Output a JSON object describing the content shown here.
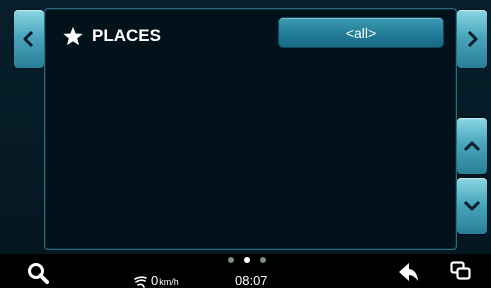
{
  "header": {
    "title": "PLACES",
    "filter_label": "<all>"
  },
  "status": {
    "speed_value": "0",
    "speed_unit": "km/h",
    "time": "08:07"
  },
  "pager": {
    "page_count": 3,
    "active_page": 2
  },
  "icons": {
    "prev": "chevron-left-icon",
    "next": "chevron-right-icon",
    "up": "chevron-up-icon",
    "down": "chevron-down-icon",
    "star": "star-icon",
    "search": "search-icon",
    "back": "back-arrow-icon",
    "windows": "windows-icon",
    "speed": "speed-icon"
  },
  "colors": {
    "accent": "#237d98",
    "button_light": "#8bd7e3"
  }
}
